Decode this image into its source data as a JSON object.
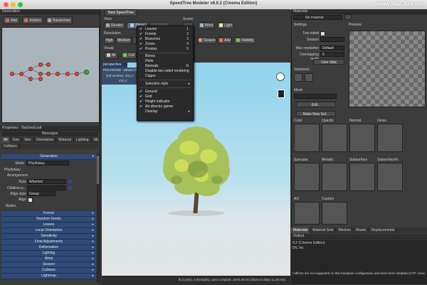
{
  "window": {
    "title": "SpeedTree Modeler v8.0.2 (Cinema Edition)",
    "watermark": "www.MacJB.com"
  },
  "generation": {
    "header": "Generation",
    "add_label": "Add",
    "actions_label": "Actions",
    "randomize_label": "Randomize"
  },
  "properties": {
    "header": "Properties - BatchedLeaf",
    "messages_label": "Messages",
    "tabs": [
      "All",
      "Gen",
      "Skin",
      "Orientation",
      "Material",
      "Lighting",
      "Wind",
      "Collision"
    ],
    "generation_section": "Generation",
    "mode_label": "Mode",
    "mode_value": "Phyllotaxy",
    "phyllotaxy_label": "Phyllotaxy",
    "arrangement_label": "Arrangement",
    "style_label": "Style",
    "style_value": "Whorled",
    "children_label": "Children p...",
    "align_style_label": "Align style",
    "align_style_value": "Group",
    "align_label": "Align",
    "nodes_label": "Nodes",
    "sections": [
      "Forces",
      "Random Seeds",
      "Leaves",
      "Local Orientation",
      "Sensitivity",
      "Final Adjustments",
      "Deformation",
      "Lighting",
      "Wind",
      "Season",
      "Collision",
      "Lightmap"
    ]
  },
  "tree_view": {
    "tab_label": "New SpeedTree",
    "view_label": "View",
    "scene_label": "Scene",
    "resolution_label": "Resolution",
    "render_label": "Render",
    "show_label": "Show",
    "wind_label": "Wind",
    "light_label": "Light",
    "high_label": "High",
    "medium_label": "Medium",
    "season_label": "Season",
    "add_label": "Add",
    "visibility_label": "Visibility",
    "visual_label": "Visual",
    "all_label": "All",
    "coll_label": "Coll",
    "viewport_mode": "perspective",
    "stats_polygons": "POLYGONS - SELECTE",
    "stats_leaf_meshes": "leaf meshes: 431,4",
    "stats_sub": "431,4",
    "status_bar": "fit (cyclic), 6 thread(s), Last Compute: 1670.28 ms (show to draw 11.29 ms)"
  },
  "dropdown": {
    "items": [
      {
        "check": "✔",
        "label": "Leaves",
        "shortcut": "1"
      },
      {
        "check": "✔",
        "label": "Fronds",
        "shortcut": "2"
      },
      {
        "check": "✔",
        "label": "Branches",
        "shortcut": "3"
      },
      {
        "check": "✔",
        "label": "Zones",
        "shortcut": "4"
      },
      {
        "check": "✔",
        "label": "Proxies",
        "shortcut": "5"
      },
      {
        "check": "",
        "label": "Bones",
        "shortcut": ""
      },
      {
        "check": "",
        "label": "Hints",
        "shortcut": ""
      },
      {
        "check": "",
        "label": "Normals",
        "shortcut": "N"
      },
      {
        "check": "",
        "label": "Disable two sided rendering",
        "shortcut": ""
      },
      {
        "check": "",
        "label": "Cages",
        "shortcut": ""
      },
      {
        "check": "",
        "label": "Selection style",
        "shortcut": ""
      },
      {
        "check": "✔",
        "label": "Ground",
        "shortcut": ""
      },
      {
        "check": "✔",
        "label": "Grid",
        "shortcut": ""
      },
      {
        "check": "✔",
        "label": "Height indicator",
        "shortcut": ""
      },
      {
        "check": "✔",
        "label": "Art director gizmo",
        "shortcut": ""
      },
      {
        "check": "",
        "label": "Overlay",
        "shortcut": ""
      }
    ]
  },
  "materials": {
    "header": "Materials",
    "no_material": "No material",
    "settings_label": "Settings",
    "preview_label": "Preview",
    "two_sided_label": "Two-sided",
    "season_label": "Season",
    "max_resolution_label": "Max resolution",
    "max_resolution_value": "Default",
    "overlapping_label": "Overlapping scale",
    "overlapping_value": "0",
    "user_data_label": "User data",
    "variations_label": "Variations",
    "mesh_label": "Mesh",
    "edit_label": "Edit...",
    "make_new_label": "Make New Set...",
    "maps": [
      "Color",
      "Opacity",
      "Normal",
      "Gloss",
      "Specular",
      "Metallic",
      "Subsurface",
      "Subsurface%",
      "AO",
      "Custom"
    ],
    "tabs": [
      "Materials",
      "Material Sets",
      "Meshes",
      "Masks",
      "Displacements"
    ]
  },
  "output": {
    "header": "Output",
    "line1": "0.2 (Cinema Edition)",
    "line2": "DV, Inc.",
    "line3": "t effects are not supported on this hardware configuration and have been disabled (VTF unavailable)"
  },
  "colors": {
    "accent_blue": "#2f4a78",
    "node_red": "#d94c3b",
    "node_green": "#3fa845",
    "sky_top": "#8fd3ec",
    "ground": "#dfe4e6"
  }
}
